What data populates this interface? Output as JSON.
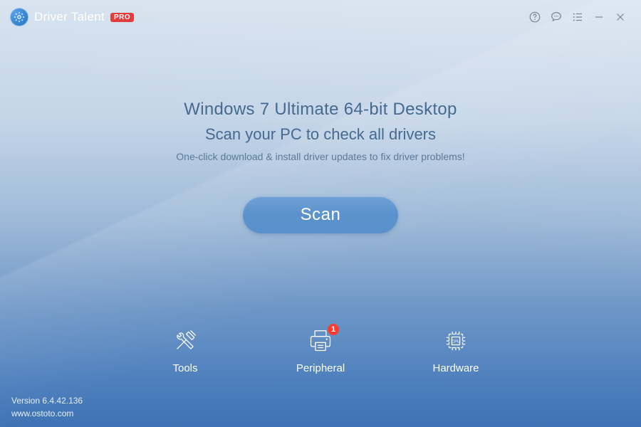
{
  "app": {
    "title": "Driver Talent",
    "badge": "PRO"
  },
  "titlebar": {
    "help": "Help",
    "feedback": "Feedback",
    "menu": "Menu",
    "minimize": "Minimize",
    "close": "Close"
  },
  "main": {
    "system": "Windows 7 Ultimate  64-bit Desktop",
    "subtitle": "Scan your PC to check all drivers",
    "description": "One-click download & install driver updates to fix driver problems!",
    "scan_label": "Scan"
  },
  "nav": {
    "tools": {
      "label": "Tools"
    },
    "peripheral": {
      "label": "Peripheral",
      "badge": "1"
    },
    "hardware": {
      "label": "Hardware"
    }
  },
  "footer": {
    "version_label": "Version",
    "version": "6.4.42.136",
    "website": "www.ostoto.com"
  }
}
